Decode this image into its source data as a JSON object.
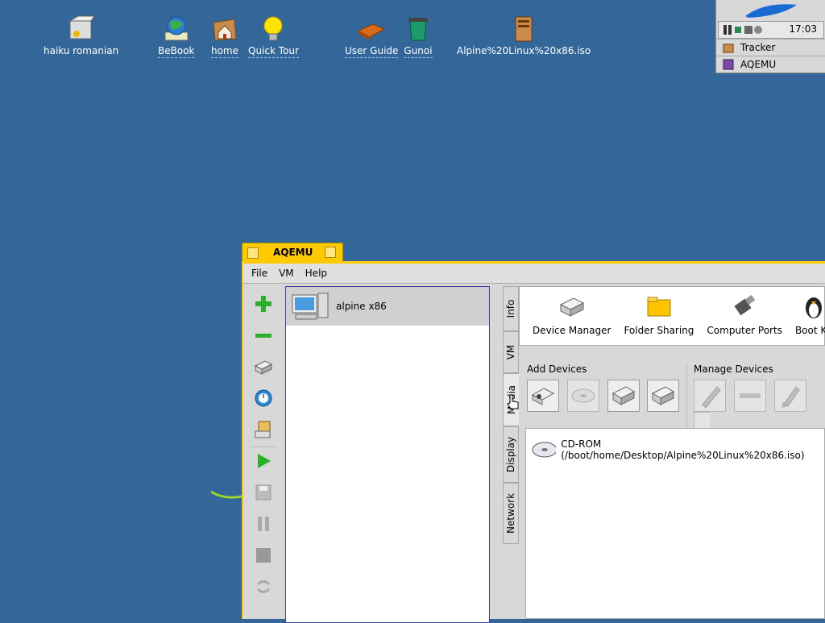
{
  "desktop": {
    "icons": [
      {
        "label": "haiku romanian",
        "icon": "drive-icon"
      },
      {
        "label": "BeBook",
        "icon": "globe-book-icon"
      },
      {
        "label": "home",
        "icon": "home-folder-icon"
      },
      {
        "label": "Quick Tour",
        "icon": "lightbulb-icon"
      },
      {
        "label": "User Guide",
        "icon": "book-icon"
      },
      {
        "label": "Gunoi",
        "icon": "trash-icon"
      },
      {
        "label": "Alpine%20Linux%20x86.iso",
        "icon": "iso-file-icon"
      }
    ]
  },
  "deskbar": {
    "clock": "17:03",
    "items": [
      {
        "label": "Tracker",
        "icon": "tracker-icon"
      },
      {
        "label": "AQEMU",
        "icon": "aqemu-icon"
      }
    ]
  },
  "window": {
    "title": "AQEMU",
    "menu": [
      "File",
      "VM",
      "Help"
    ],
    "vm_list": [
      {
        "name": "alpine x86"
      }
    ],
    "side_tabs": [
      "Info",
      "VM",
      "Media",
      "Display",
      "Network"
    ],
    "tools": [
      "Device Manager",
      "Folder Sharing",
      "Computer Ports",
      "Boot Ke"
    ],
    "add_devices_label": "Add Devices",
    "manage_devices_label": "Manage Devices",
    "devices": [
      {
        "label": "CD-ROM (/boot/home/Desktop/Alpine%20Linux%20x86.iso)",
        "icon": "cdrom-icon"
      }
    ]
  },
  "colors": {
    "desktop": "#336699",
    "title_tab": "#ffcb00"
  }
}
